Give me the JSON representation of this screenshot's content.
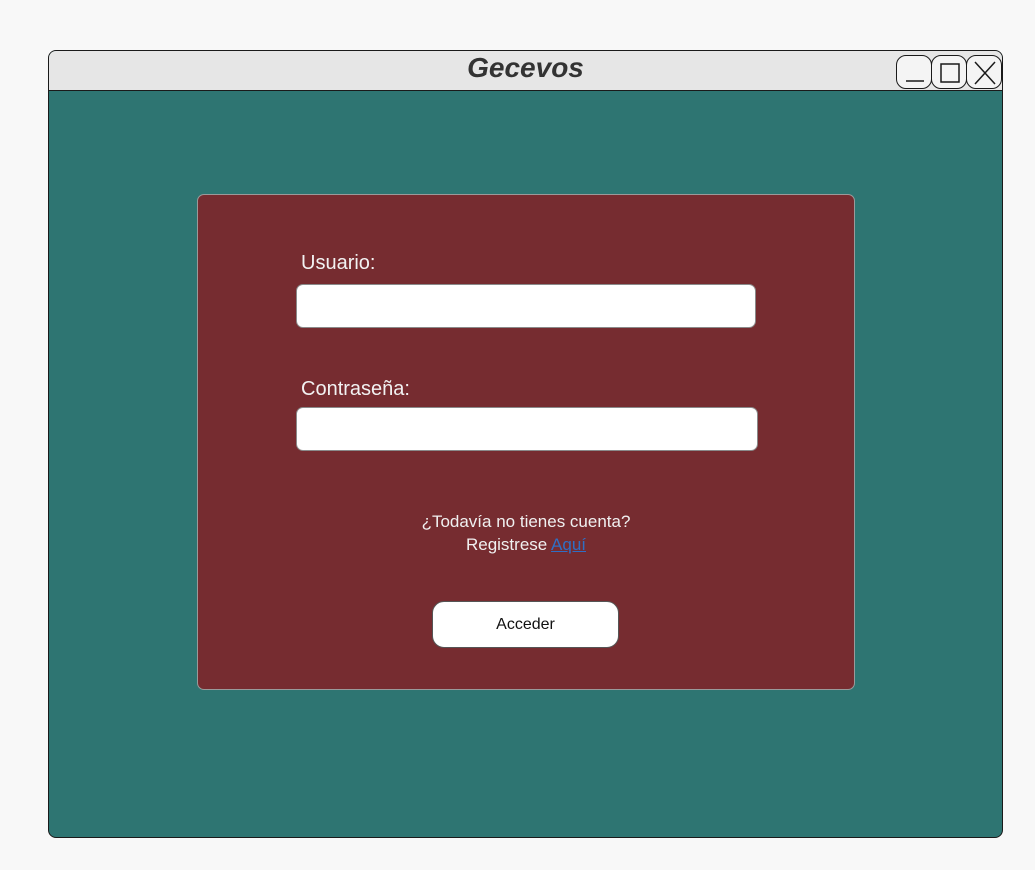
{
  "window": {
    "title": "Gecevos",
    "controls": {
      "minimize_icon": "minimize-icon",
      "maximize_icon": "maximize-icon",
      "close_icon": "close-icon"
    },
    "colors": {
      "background": "#2e7572",
      "titlebar": "#e6e6e6"
    }
  },
  "login": {
    "colors": {
      "card": "#762c30",
      "link": "#2f6fc4"
    },
    "username": {
      "label": "Usuario:",
      "value": "",
      "placeholder": ""
    },
    "password": {
      "label": "Contraseña:",
      "value": "",
      "placeholder": ""
    },
    "signup_question": "¿Todavía no tienes cuenta?",
    "signup_prefix": "Registrese",
    "signup_link": "Aquí",
    "submit_label": "Acceder"
  }
}
